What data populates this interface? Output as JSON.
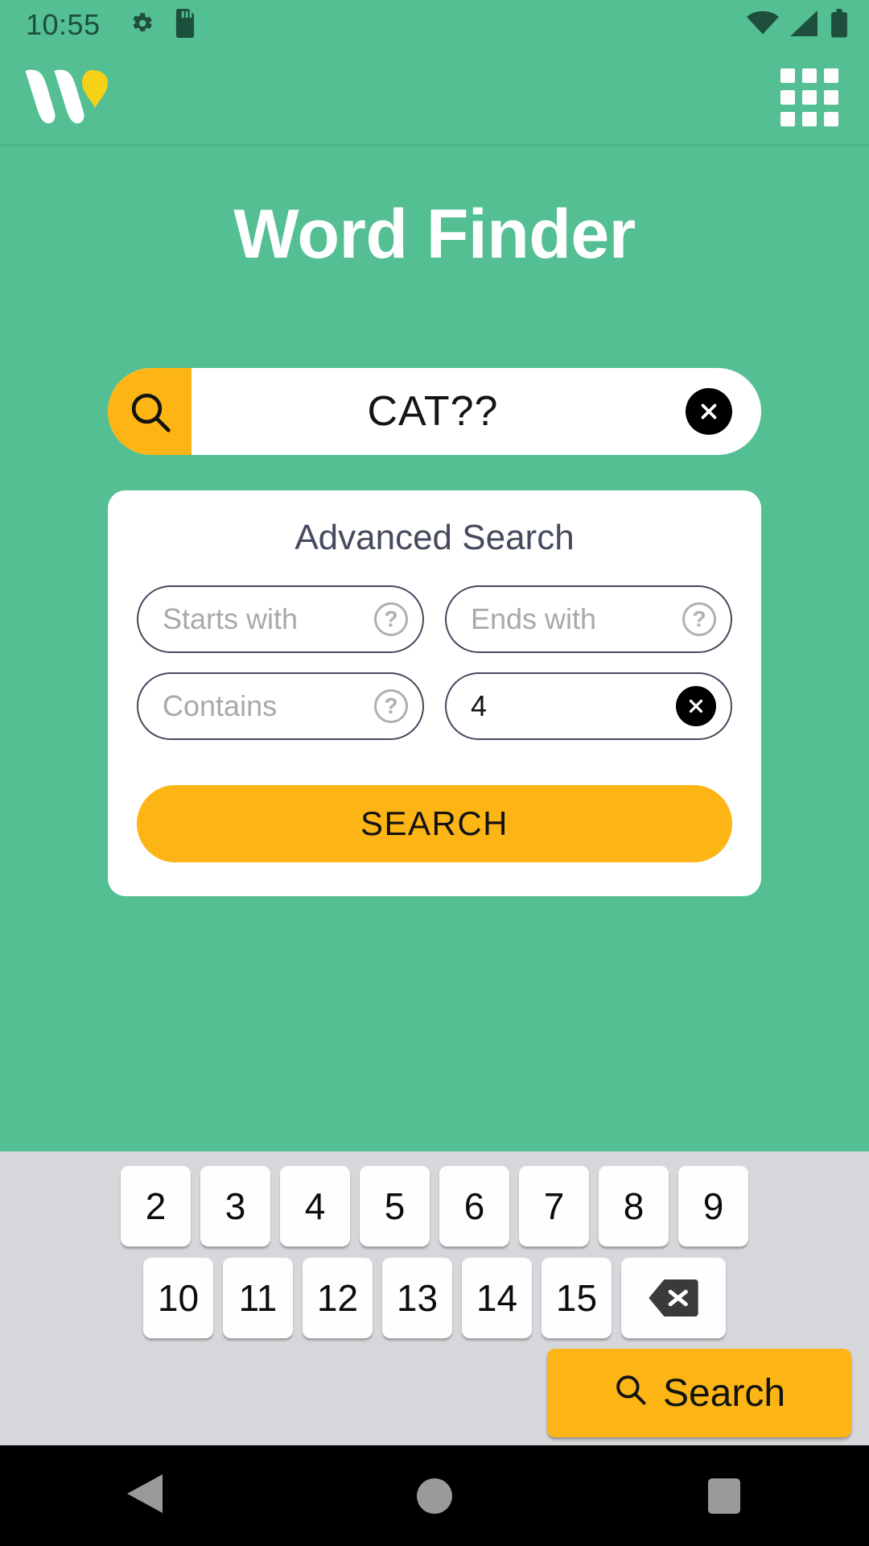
{
  "status_bar": {
    "time": "10:55",
    "left_icons": [
      "gear-icon",
      "sd-card-icon"
    ],
    "right_icons": [
      "wifi-icon",
      "cell-signal-icon",
      "battery-icon"
    ],
    "color": "#1d4f3c"
  },
  "app_bar": {
    "logo_name": "wordfinder-w-logo",
    "menu_icon": "grid-menu-icon",
    "background": "#53bf93"
  },
  "main": {
    "title": "Word Finder",
    "search": {
      "icon": "magnifier-icon",
      "value": "CAT??",
      "clear_icon": "clear-circle-icon",
      "accent": "#fcb514"
    },
    "advanced": {
      "title": "Advanced Search",
      "fields": [
        {
          "name": "starts-with",
          "placeholder": "Starts with",
          "value": "",
          "trailing": "help-icon"
        },
        {
          "name": "ends-with",
          "placeholder": "Ends with",
          "value": "",
          "trailing": "help-icon"
        },
        {
          "name": "contains",
          "placeholder": "Contains",
          "value": "",
          "trailing": "help-icon"
        },
        {
          "name": "length",
          "placeholder": "",
          "value": "4",
          "trailing": "clear-icon"
        }
      ],
      "submit_label": "SEARCH"
    }
  },
  "keyboard": {
    "row1": [
      "2",
      "3",
      "4",
      "5",
      "6",
      "7",
      "8",
      "9"
    ],
    "row2": [
      "10",
      "11",
      "12",
      "13",
      "14",
      "15"
    ],
    "backspace_icon": "backspace-icon",
    "search_key": {
      "label": "Search",
      "icon": "magnifier-icon",
      "color": "#fcb514"
    },
    "background": "#d6d7da"
  },
  "nav_bar": {
    "back_icon": "triangle-back-icon",
    "home_icon": "circle-home-icon",
    "recents_icon": "square-recents-icon"
  },
  "colors": {
    "brand_green": "#53bf93",
    "accent_yellow": "#fcb514",
    "dark_green": "#1d4f3c",
    "field_outline": "#454a5e"
  }
}
